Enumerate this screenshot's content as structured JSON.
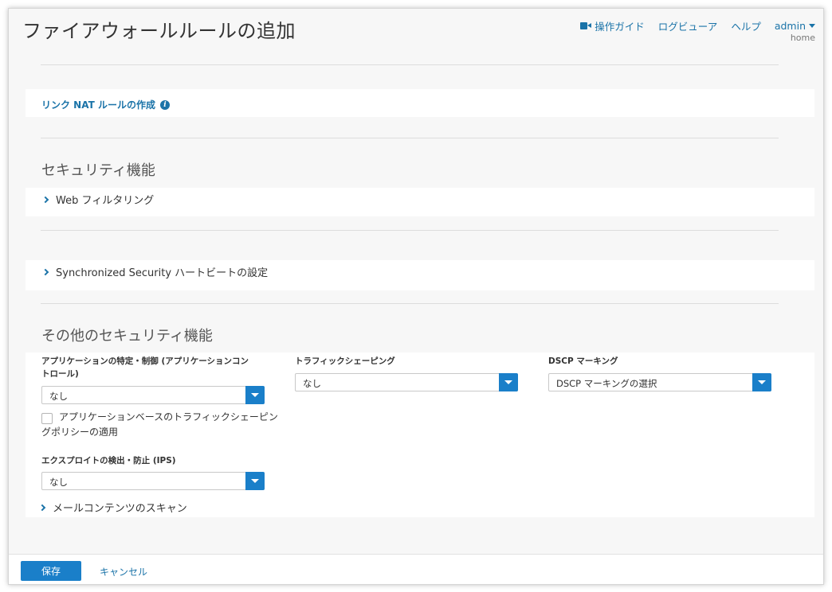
{
  "header": {
    "title": "ファイアウォールルールの追加",
    "nav": {
      "guide_label": "操作ガイド",
      "log_viewer_label": "ログビューア",
      "help_label": "ヘルプ",
      "user_label": "admin",
      "user_sub": "home"
    }
  },
  "link_nat": {
    "label": "リンク NAT ルールの作成",
    "info_glyph": "i"
  },
  "security": {
    "title": "セキュリティ機能",
    "web_filtering_label": "Web フィルタリング"
  },
  "heartbeat": {
    "label": "Synchronized Security ハートビートの設定"
  },
  "other_security": {
    "title": "その他のセキュリティ機能",
    "app_control": {
      "label_line1": "アプリケーションの特定・制御 (アプリケーションコン",
      "label_line2": "トロール)",
      "value": "なし"
    },
    "app_traffic_checkbox": {
      "label_line1": "アプリケーションベースのトラフィックシェーピン",
      "label_line2": "グポリシーの適用",
      "checked": false
    },
    "ips": {
      "label": "エクスプロイトの検出・防止 (IPS)",
      "value": "なし"
    },
    "traffic_shaping": {
      "label": "トラフィックシェーピング",
      "value": "なし"
    },
    "dscp": {
      "label": "DSCP マーキング",
      "value": "DSCP マーキングの選択"
    },
    "mail_scan_label": "メールコンテンツのスキャン"
  },
  "footer": {
    "save_label": "保存",
    "cancel_label": "キャンセル"
  },
  "colors": {
    "accent": "#1a7fc9",
    "link": "#1a73a8"
  }
}
